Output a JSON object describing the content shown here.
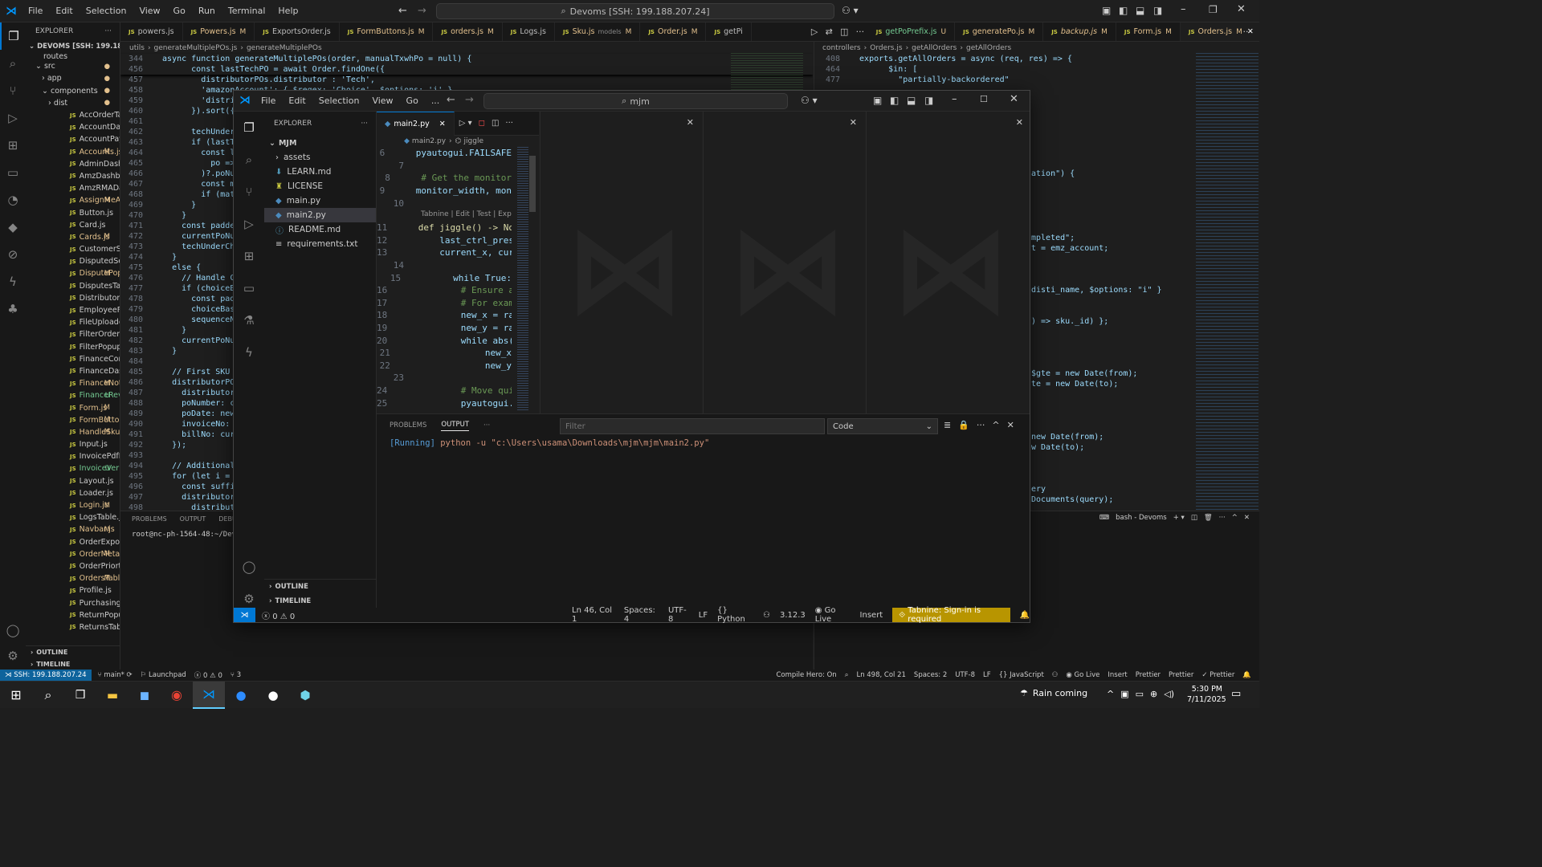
{
  "titlebar": {
    "menu": [
      "File",
      "Edit",
      "Selection",
      "View",
      "Go",
      "Run",
      "Terminal",
      "Help"
    ],
    "search": "Devoms [SSH: 199.188.207.24]"
  },
  "explorer": {
    "title": "EXPLORER",
    "root": "DEVOMS [SSH: 199.188.20...",
    "folders": [
      {
        "name": "routes"
      },
      {
        "name": "src"
      },
      {
        "name": "app"
      },
      {
        "name": "components"
      },
      {
        "name": "dist"
      }
    ],
    "files": [
      {
        "name": "AccOrderTable.js",
        "mark": ""
      },
      {
        "name": "AccountDashboar...",
        "mark": ""
      },
      {
        "name": "AccountPaymentP...",
        "mark": ""
      },
      {
        "name": "Accounts.js",
        "mark": "M"
      },
      {
        "name": "AdminDashboard.js",
        "mark": ""
      },
      {
        "name": "AmzDashboard.js",
        "mark": ""
      },
      {
        "name": "AmzRMADashboar...",
        "mark": ""
      },
      {
        "name": "AssignMeAO...",
        "mark": "M"
      },
      {
        "name": "Button.js",
        "mark": ""
      },
      {
        "name": "Card.js",
        "mark": ""
      },
      {
        "name": "Cards.js",
        "mark": "M"
      },
      {
        "name": "CustomerSection.js",
        "mark": ""
      },
      {
        "name": "DisputedSection.js",
        "mark": ""
      },
      {
        "name": "DisputePopu...",
        "mark": "M"
      },
      {
        "name": "DisputesTable.js",
        "mark": ""
      },
      {
        "name": "DistributorForm.js",
        "mark": ""
      },
      {
        "name": "EmployeeForm.js",
        "mark": ""
      },
      {
        "name": "FileUploader.js",
        "mark": ""
      },
      {
        "name": "FilterOrdersTable.js",
        "mark": ""
      },
      {
        "name": "FilterPopup.js",
        "mark": ""
      },
      {
        "name": "FinanceComments.js",
        "mark": ""
      },
      {
        "name": "FinanceDashboard.js",
        "mark": ""
      },
      {
        "name": "FinanceNotV...",
        "mark": "M"
      },
      {
        "name": "FinanceReveri...",
        "mark": "U"
      },
      {
        "name": "Form.js",
        "mark": "M"
      },
      {
        "name": "FormButtons.js",
        "mark": "M"
      },
      {
        "name": "HandleSkus.js",
        "mark": "M"
      },
      {
        "name": "Input.js",
        "mark": ""
      },
      {
        "name": "InvoicePdfPopup.js",
        "mark": ""
      },
      {
        "name": "InvoiceVerific...",
        "mark": "U"
      },
      {
        "name": "Layout.js",
        "mark": ""
      },
      {
        "name": "Loader.js",
        "mark": ""
      },
      {
        "name": "Login.js",
        "mark": "M"
      },
      {
        "name": "LogsTable.js",
        "mark": ""
      },
      {
        "name": "Navbar.js",
        "mark": "M"
      },
      {
        "name": "OrderExportPopup.js",
        "mark": ""
      },
      {
        "name": "OrderMetaD...",
        "mark": "M"
      },
      {
        "name": "OrderPriorty.js",
        "mark": ""
      },
      {
        "name": "OrdersTable.js",
        "mark": "M"
      },
      {
        "name": "Profile.js",
        "mark": ""
      },
      {
        "name": "PurchasingDashbo...",
        "mark": ""
      },
      {
        "name": "ReturnPopup.js",
        "mark": ""
      },
      {
        "name": "ReturnsTable.js",
        "mark": ""
      }
    ],
    "outline": "OUTLINE",
    "timeline": "TIMELINE"
  },
  "tabs_left": [
    {
      "name": "powers.js",
      "mark": ""
    },
    {
      "name": "Powers.js",
      "mark": "M"
    },
    {
      "name": "ExportsOrder.js",
      "mark": ""
    },
    {
      "name": "FormButtons.js",
      "mark": "M"
    },
    {
      "name": "orders.js",
      "mark": "M"
    },
    {
      "name": "Logs.js",
      "mark": ""
    },
    {
      "name": "Sku.js",
      "sub": "models",
      "mark": "M"
    },
    {
      "name": "Order.js",
      "mark": "M"
    },
    {
      "name": "getPi",
      "mark": ""
    }
  ],
  "tabs_right": [
    {
      "name": "getPoPrefix.js",
      "mark": "U"
    },
    {
      "name": "generatePo.js",
      "mark": "M"
    },
    {
      "name": "backup.js",
      "mark": "M"
    },
    {
      "name": "Form.js",
      "mark": "M"
    },
    {
      "name": "Orders.js",
      "mark": "M"
    }
  ],
  "left_editor": {
    "breadcrumb": [
      "utils",
      "generateMultiplePOs.js",
      "generateMultiplePOs"
    ],
    "sticky": [
      {
        "n": "344",
        "t": "  async function generateMultiplePOs(order, manualTxwhPo = null) {"
      },
      {
        "n": "456",
        "t": "        const lastTechPO = await Order.findOne({"
      }
    ],
    "lines": [
      {
        "n": "457",
        "t": "          distributorPOs.distributor : 'Tech',"
      },
      {
        "n": "458",
        "t": "          'amazonAccount': { $regex: 'Choice', $options: 'i' },"
      },
      {
        "n": "459",
        "t": "          'distri"
      },
      {
        "n": "460",
        "t": "        }).sort({"
      },
      {
        "n": "461",
        "t": ""
      },
      {
        "n": "462",
        "t": "        techUnderC"
      },
      {
        "n": "463",
        "t": "        if (lastTe"
      },
      {
        "n": "464",
        "t": "          const la"
      },
      {
        "n": "465",
        "t": "            po =>"
      },
      {
        "n": "466",
        "t": "          )?.poNum"
      },
      {
        "n": "467",
        "t": "          const m"
      },
      {
        "n": "468",
        "t": "          if (mat"
      },
      {
        "n": "469",
        "t": "        }"
      },
      {
        "n": "470",
        "t": "      }"
      },
      {
        "n": "471",
        "t": "      const padde"
      },
      {
        "n": "472",
        "t": "      currentPoNu"
      },
      {
        "n": "473",
        "t": "      techUnderCh"
      },
      {
        "n": "474",
        "t": "    }"
      },
      {
        "n": "475",
        "t": "    else {"
      },
      {
        "n": "476",
        "t": "      // Handle C"
      },
      {
        "n": "477",
        "t": "      if (choiceB"
      },
      {
        "n": "478",
        "t": "        const padd"
      },
      {
        "n": "479",
        "t": "        choiceBase"
      },
      {
        "n": "480",
        "t": "        sequenceN"
      },
      {
        "n": "481",
        "t": "      }"
      },
      {
        "n": "482",
        "t": "      currentPoNu"
      },
      {
        "n": "483",
        "t": "    }"
      },
      {
        "n": "484",
        "t": ""
      },
      {
        "n": "485",
        "t": "    // First SKU"
      },
      {
        "n": "486",
        "t": "    distributorPO"
      },
      {
        "n": "487",
        "t": "      distributor"
      },
      {
        "n": "488",
        "t": "      poNumber: c"
      },
      {
        "n": "489",
        "t": "      poDate: new"
      },
      {
        "n": "490",
        "t": "      invoiceNo:"
      },
      {
        "n": "491",
        "t": "      billNo: cur"
      },
      {
        "n": "492",
        "t": "    });"
      },
      {
        "n": "493",
        "t": ""
      },
      {
        "n": "494",
        "t": "    // Additional"
      },
      {
        "n": "495",
        "t": "    for (let i ="
      },
      {
        "n": "496",
        "t": "      const suffi"
      },
      {
        "n": "497",
        "t": "      distributor"
      },
      {
        "n": "498",
        "t": "        distribut"
      }
    ]
  },
  "right_editor": {
    "breadcrumb": [
      "controllers",
      "Orders.js",
      "getAllOrders",
      "getAllOrders"
    ],
    "sticky": [
      {
        "n": "408",
        "t": "  exports.getAllOrders = async (req, res) => {"
      },
      {
        "n": "464",
        "t": "        $in: ["
      },
      {
        "n": "477",
        "t": "          \"partially-backordered\""
      }
    ],
    "fragments": [
      "ation\") {",
      "mpleted\";",
      "t = emz_account;",
      "disti_name, $options: \"i\" }",
      ") => sku._id) };",
      "$gte = new Date(from);",
      "te = new Date(to);",
      "new Date(from);",
      "w Date(to);",
      "ery",
      "Documents(query);"
    ]
  },
  "bottom_left_panel": {
    "tabs": [
      "PROBLEMS",
      "OUTPUT",
      "DEBUG C"
    ],
    "terminal": "root@nc-ph-1564-48:~/Devom"
  },
  "bottom_right_panel": {
    "terminal_name": "bash - Devoms"
  },
  "main_status": {
    "remote": "SSH: 199.188.207.24",
    "branch": "main*",
    "launchpad": "Launchpad",
    "errors": "0",
    "warnings": "0",
    "ports": "3",
    "compile_hero": "Compile Hero: On",
    "position": "Ln 498, Col 21",
    "spaces": "Spaces: 2",
    "encoding": "UTF-8",
    "eol": "LF",
    "language": "JavaScript",
    "golive": "Go Live",
    "insert": "Insert",
    "prettier1": "Prettier",
    "prettier2": "Prettier",
    "prettier3": "Prettier"
  },
  "win": {
    "menu": [
      "File",
      "Edit",
      "Selection",
      "View",
      "Go",
      "..."
    ],
    "search": "mjm",
    "explorer_title": "EXPLORER",
    "folder": "MJM",
    "items": [
      {
        "name": "assets",
        "type": "folder"
      },
      {
        "name": "LEARN.md",
        "type": "md"
      },
      {
        "name": "LICENSE",
        "type": "license"
      },
      {
        "name": "main.py",
        "type": "py"
      },
      {
        "name": "main2.py",
        "type": "py"
      },
      {
        "name": "README.md",
        "type": "info"
      },
      {
        "name": "requirements.txt",
        "type": "txt"
      }
    ],
    "outline": "OUTLINE",
    "timeline": "TIMELINE",
    "tab": "main2.py",
    "breadcrumb": [
      "main2.py",
      "jiggle"
    ],
    "codelens": "Tabnine | Edit | Test | Expla",
    "code": [
      {
        "n": "6",
        "t": "    pyautogui.FAILSAFE"
      },
      {
        "n": "7",
        "t": ""
      },
      {
        "n": "8",
        "t": "    # Get the monitor"
      },
      {
        "n": "9",
        "t": "    monitor_width, mon"
      },
      {
        "n": "10",
        "t": ""
      },
      {
        "n": "11",
        "t": "    def jiggle() -> No"
      },
      {
        "n": "12",
        "t": "        last_ctrl_pres"
      },
      {
        "n": "13",
        "t": "        current_x, cur"
      },
      {
        "n": "14",
        "t": ""
      },
      {
        "n": "15",
        "t": "        while True:"
      },
      {
        "n": "16",
        "t": "            # Ensure a"
      },
      {
        "n": "17",
        "t": "            # For exam"
      },
      {
        "n": "18",
        "t": "            new_x = ra"
      },
      {
        "n": "19",
        "t": "            new_y = ra"
      },
      {
        "n": "20",
        "t": "            while abs("
      },
      {
        "n": "21",
        "t": "                new_x"
      },
      {
        "n": "22",
        "t": "                new_y"
      },
      {
        "n": "23",
        "t": ""
      },
      {
        "n": "24",
        "t": "            # Move qui"
      },
      {
        "n": "25",
        "t": "            pyautogui."
      }
    ],
    "panel_tabs": [
      "PROBLEMS",
      "OUTPUT"
    ],
    "filter_placeholder": "Filter",
    "output_channel": "Code",
    "output_line_label": "[Running]",
    "output_line_cmd": " python -u \"c:\\Users\\usama\\Downloads\\mjm\\mjm\\main2.py\"",
    "status": {
      "errors": "0",
      "warnings": "0",
      "position": "Ln 46, Col 1",
      "spaces": "Spaces: 4",
      "encoding": "UTF-8",
      "eol": "LF",
      "language": "Python",
      "version": "3.12.3",
      "golive": "Go Live",
      "insert": "Insert",
      "tabnine": "Tabnine: Sign-in is required"
    }
  },
  "taskbar": {
    "weather": "Rain coming",
    "time": "5:30 PM",
    "date": "7/11/2025"
  },
  "colors": {
    "accent": "#0078d4",
    "status_remote": "#0e639c",
    "tabnine_bg": "#b89500"
  }
}
